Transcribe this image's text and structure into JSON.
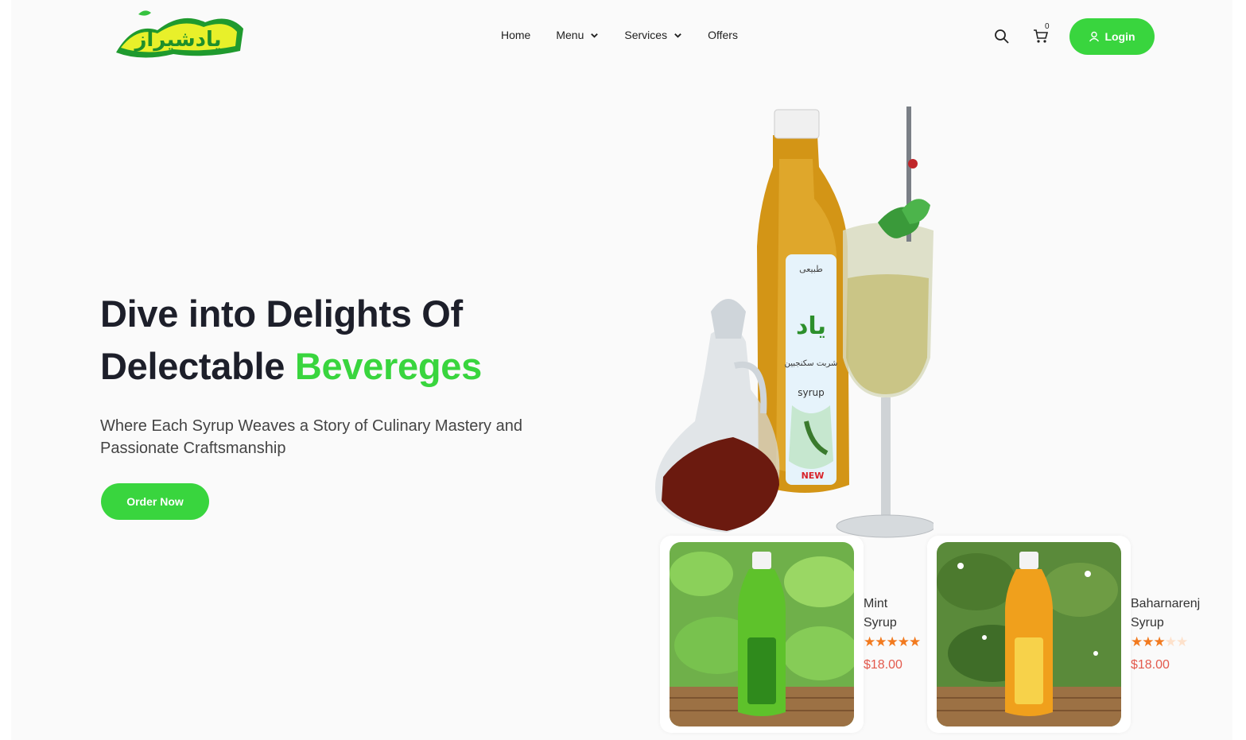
{
  "header": {
    "logo_text": "یادشیراز",
    "nav": [
      {
        "label": "Home",
        "has_dropdown": false
      },
      {
        "label": "Menu",
        "has_dropdown": true
      },
      {
        "label": "Services",
        "has_dropdown": true
      },
      {
        "label": "Offers",
        "has_dropdown": false
      }
    ],
    "cart_count": "0",
    "login_label": "Login"
  },
  "hero": {
    "title_line1": "Dive into Delights Of",
    "title_line2_prefix": "Delectable ",
    "title_line2_accent": "Bevereges",
    "subtitle": "Where Each Syrup Weaves a Story of Culinary Mastery and Passionate Craftsmanship",
    "cta_label": "Order Now",
    "bottle_label_top": "طبیعی",
    "bottle_label_brand": "یاد",
    "bottle_label_fa": "شربت سکنجبین",
    "bottle_label_en": "syrup",
    "bottle_label_new": "NEW"
  },
  "products": [
    {
      "name_line1": "Mint",
      "name_line2": "Syrup",
      "rating": 5,
      "price": "$18.00",
      "label": "Mint Syrup"
    },
    {
      "name_line1": "Baharnarenj",
      "name_line2": "Syrup",
      "rating": 3,
      "price": "$18.00",
      "label": "Baharnarenj Syrup"
    }
  ],
  "colors": {
    "accent": "#39d53e",
    "price": "#e35a4d",
    "star": "#f27a1f",
    "heading": "#1d1f2a"
  },
  "icons": [
    "search-icon",
    "cart-icon",
    "user-icon",
    "chevron-down-icon",
    "star-icon"
  ]
}
